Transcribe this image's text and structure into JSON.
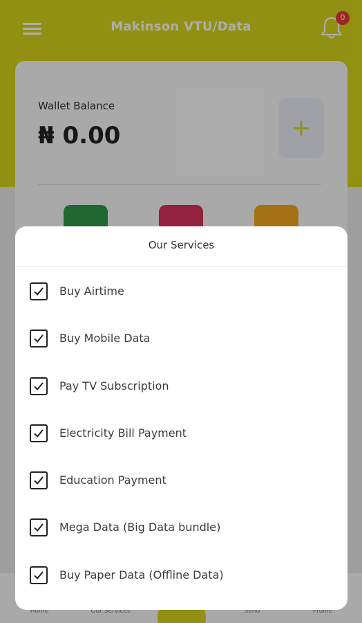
{
  "header": {
    "title": "Makinson VTU/Data",
    "notification_count": "0"
  },
  "wallet": {
    "label": "Wallet Balance",
    "amount": "₦ 0.00",
    "add_icon": "plus-icon"
  },
  "bottom_nav": {
    "items": [
      "Home",
      "Our Services",
      "Send",
      "Profile"
    ]
  },
  "dialog": {
    "title": "Our Services",
    "services": [
      {
        "label": "Buy Airtime",
        "checked": true
      },
      {
        "label": "Buy Mobile Data",
        "checked": true
      },
      {
        "label": "Pay TV Subscription",
        "checked": true
      },
      {
        "label": "Electricity Bill Payment",
        "checked": true
      },
      {
        "label": "Education Payment",
        "checked": true
      },
      {
        "label": "Mega Data (Big Data bundle)",
        "checked": true
      },
      {
        "label": "Buy Paper Data (Offline Data)",
        "checked": true
      }
    ]
  },
  "colors": {
    "brand_yellow": "#d8d41b",
    "tile_green": "#2e9a4a",
    "tile_red": "#d7335a",
    "tile_orange": "#f2a91d",
    "badge_red": "#e53935"
  }
}
